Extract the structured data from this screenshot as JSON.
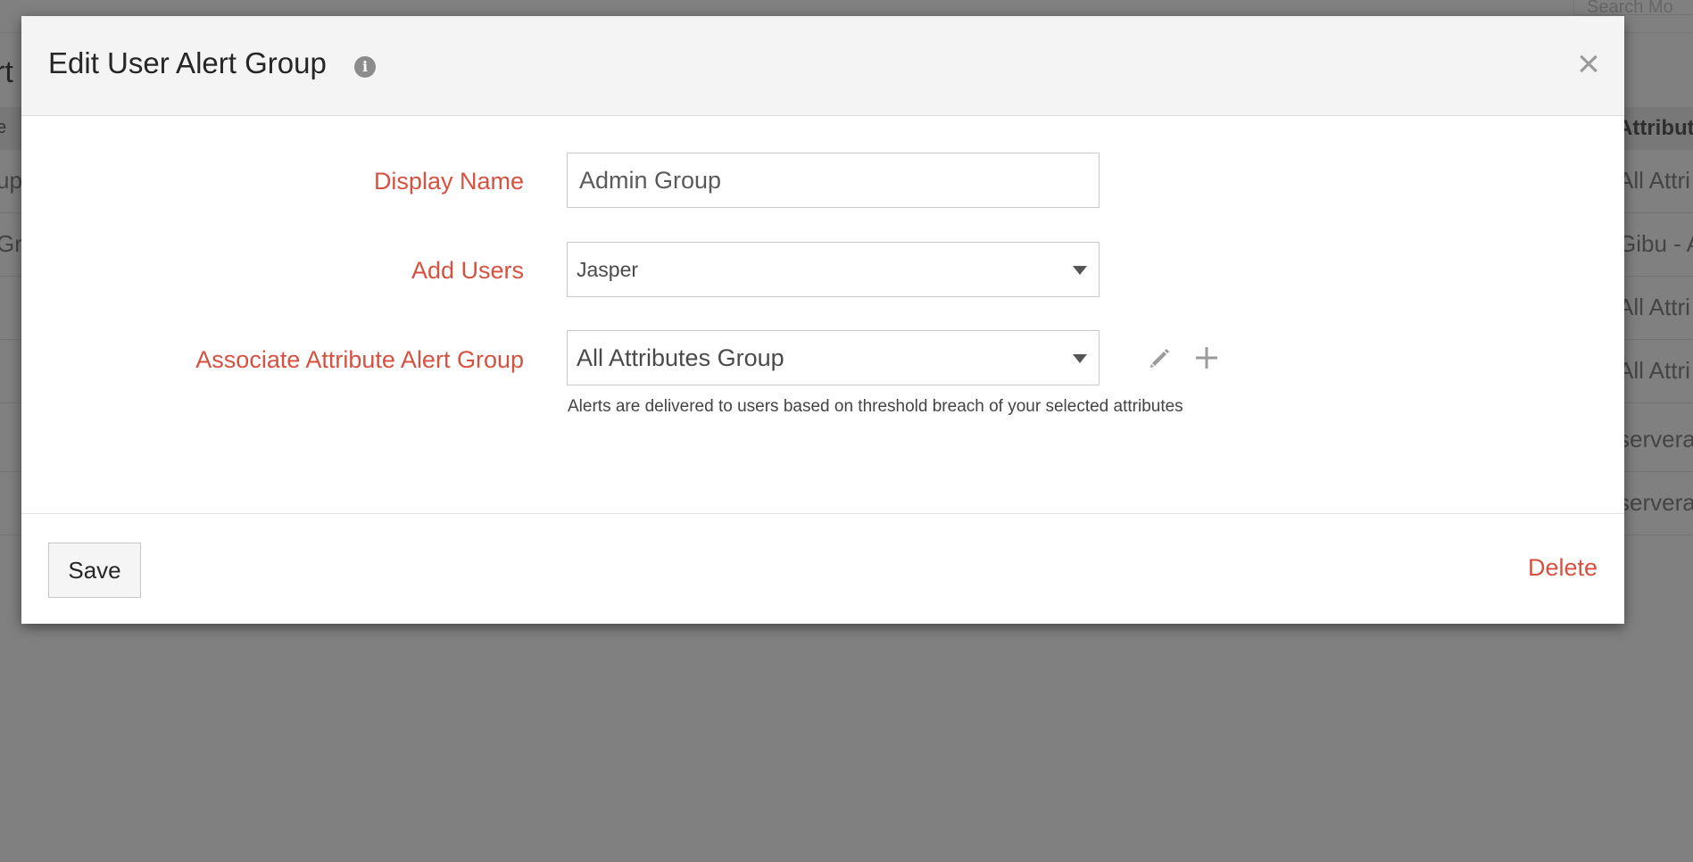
{
  "background": {
    "search_placeholder": "Search Mo",
    "page_title": "rt",
    "left_column_header": "e",
    "right_column_header": "Attribute",
    "rows": [
      {
        "left": "up",
        "right": "All Attri"
      },
      {
        "left": "Gro",
        "right": "Gibu - A"
      },
      {
        "left": "",
        "right": "All Attri"
      },
      {
        "left": "",
        "right": "All Attri"
      },
      {
        "left": "",
        "right": "servera"
      },
      {
        "left": "",
        "right": "servera"
      }
    ]
  },
  "modal": {
    "title": "Edit User Alert Group",
    "info_icon_glyph": "i",
    "close_glyph": "×",
    "fields": {
      "display_name": {
        "label": "Display Name",
        "value": "Admin Group"
      },
      "add_users": {
        "label": "Add Users",
        "value": "Jasper"
      },
      "attribute_group": {
        "label": "Associate Attribute Alert Group",
        "value": "All Attributes Group",
        "help": "Alerts are delivered to users based on threshold breach of your selected attributes"
      }
    },
    "footer": {
      "save_label": "Save",
      "delete_label": "Delete"
    }
  },
  "colors": {
    "accent_red": "#d6513f",
    "overlay_gray": "#808080",
    "header_bg": "#f4f4f4"
  }
}
